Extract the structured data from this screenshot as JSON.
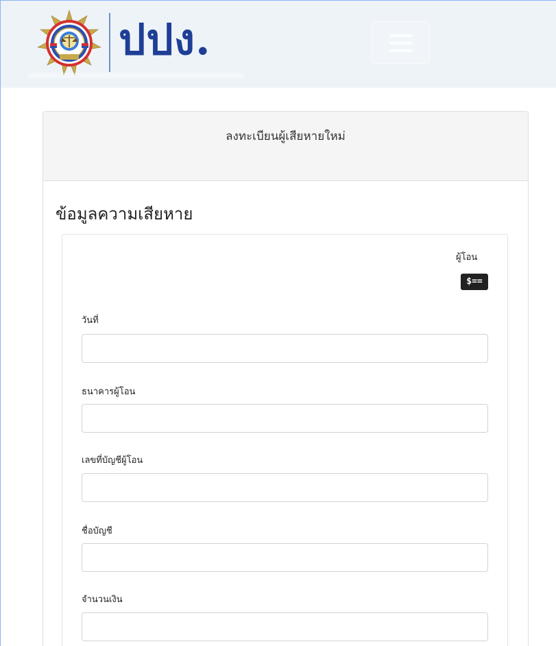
{
  "header": {
    "logo_text": "ปปง.",
    "logo_icon": "agency-seal-icon",
    "menu_icon": "hamburger-menu-icon"
  },
  "card": {
    "title": "ลงทะเบียนผู้เสียหายใหม่"
  },
  "section": {
    "title": "ข้อมูลความเสียหาย",
    "transfer_label": "ผู้โอน",
    "money_icon": "money-icon",
    "money_icon_glyph": "$=="
  },
  "fields": [
    {
      "label": "วันที่",
      "value": "",
      "placeholder": ""
    },
    {
      "label": "ธนาคารผู้โอน",
      "value": "",
      "placeholder": ""
    },
    {
      "label": "เลขที่บัญชีผู้โอน",
      "value": "",
      "placeholder": ""
    },
    {
      "label": "ชื่อบัญชี",
      "value": "",
      "placeholder": ""
    },
    {
      "label": "จำนวนเงิน",
      "value": "",
      "placeholder": ""
    }
  ],
  "colors": {
    "header_bg": "#eef3f8",
    "logo_blue": "#1f3f96",
    "card_header_bg": "#f5f5f5"
  }
}
